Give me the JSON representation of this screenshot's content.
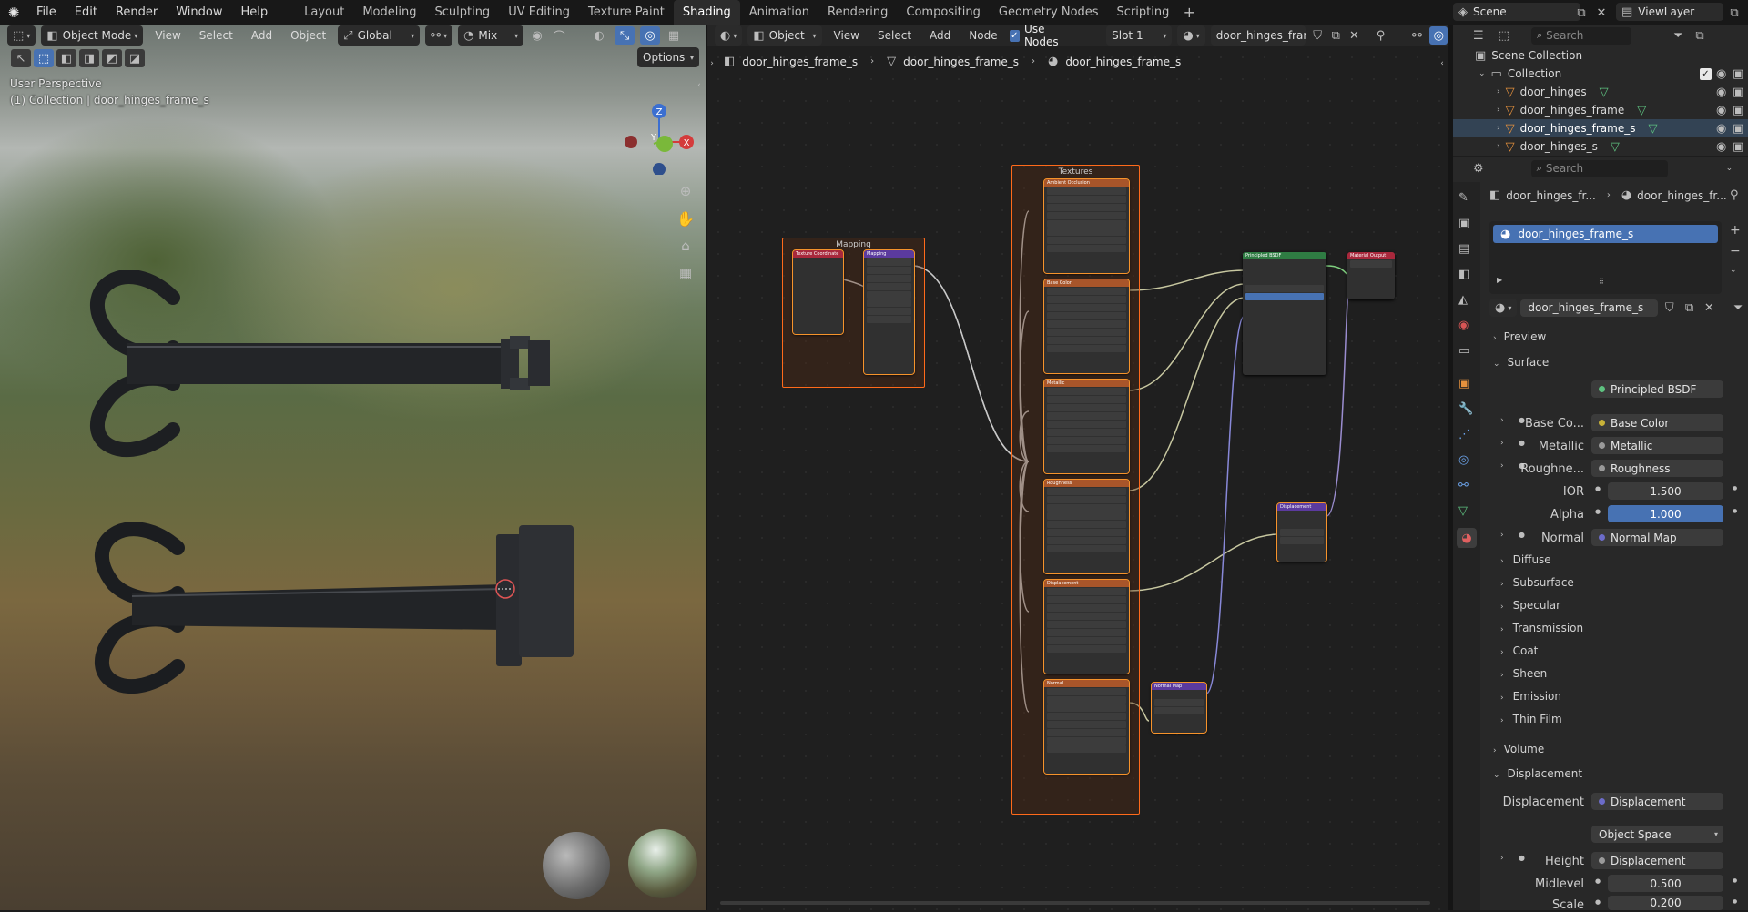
{
  "menus": [
    "File",
    "Edit",
    "Render",
    "Window",
    "Help"
  ],
  "workspaces": [
    "Layout",
    "Modeling",
    "Sculpting",
    "UV Editing",
    "Texture Paint",
    "Shading",
    "Animation",
    "Rendering",
    "Compositing",
    "Geometry Nodes",
    "Scripting"
  ],
  "active_workspace": "Shading",
  "scene": "Scene",
  "view_layer": "ViewLayer",
  "viewport": {
    "mode": "Object Mode",
    "menu": [
      "View",
      "Select",
      "Add",
      "Object"
    ],
    "orientation": "Global",
    "blend": "Mix",
    "options": "Options",
    "perspective": "User Perspective",
    "collection_label": "(1) Collection | door_hinges_frame_s",
    "axes": [
      "X",
      "Y",
      "Z"
    ]
  },
  "node_editor": {
    "type": "Object",
    "menu": [
      "View",
      "Select",
      "Add",
      "Node"
    ],
    "use_nodes": "Use Nodes",
    "slot": "Slot 1",
    "material": "door_hinges_frame_s",
    "breadcrumb": [
      "door_hinges_frame_s",
      "door_hinges_frame_s",
      "door_hinges_frame_s"
    ],
    "frames": {
      "mapping": "Mapping",
      "textures": "Textures"
    },
    "nodes": {
      "texcoord": "Texture Coordinate",
      "mapping": "Mapping",
      "ao": "Ambient Occlusion",
      "basecolor": "Base Color",
      "metallic": "Metallic",
      "roughness": "Roughness",
      "displacement": "Displacement",
      "normal": "Normal",
      "bsdf": "Principled BSDF",
      "output": "Material Output",
      "disp_node": "Displacement",
      "normalmap": "Normal Map"
    }
  },
  "outliner": {
    "search_placeholder": "Search",
    "scene_collection": "Scene Collection",
    "collection": "Collection",
    "items": [
      "door_hinges",
      "door_hinges_frame",
      "door_hinges_frame_s",
      "door_hinges_s"
    ]
  },
  "properties": {
    "search_placeholder": "Search",
    "breadcrumb": [
      "door_hinges_fr...",
      "door_hinges_fr..."
    ],
    "slot_name": "door_hinges_frame_s",
    "material_name": "door_hinges_frame_s",
    "sections": {
      "preview": "Preview",
      "surface": "Surface",
      "volume": "Volume",
      "displacement": "Displacement"
    },
    "surface_label": "Surface",
    "surface_value": "Principled BSDF",
    "fields": [
      {
        "label": "Base Co...",
        "value": "Base Color",
        "color": "#c8b238"
      },
      {
        "label": "Metallic",
        "value": "Metallic",
        "color": "#9a9a9a"
      },
      {
        "label": "Roughne...",
        "value": "Roughness",
        "color": "#9a9a9a"
      },
      {
        "label": "IOR",
        "value": "1.500",
        "color": "#9a9a9a"
      },
      {
        "label": "Alpha",
        "value": "1.000",
        "color": "#9a9a9a"
      },
      {
        "label": "Normal",
        "value": "Normal Map",
        "color": "#6c6cc9"
      }
    ],
    "subpanels": [
      "Diffuse",
      "Subsurface",
      "Specular",
      "Transmission",
      "Coat",
      "Sheen",
      "Emission",
      "Thin Film"
    ],
    "disp": {
      "displacement_label": "Displacement",
      "displacement_value": "Displacement",
      "space": "Object Space",
      "height_label": "Height",
      "height_value": "Displacement",
      "midlevel_label": "Midlevel",
      "midlevel_value": "0.500",
      "scale_label": "Scale",
      "scale_value": "0.200"
    }
  },
  "colors": {
    "accent": "#4772b3",
    "frame": "#ff6a1a",
    "link": "#c7c7a0"
  }
}
